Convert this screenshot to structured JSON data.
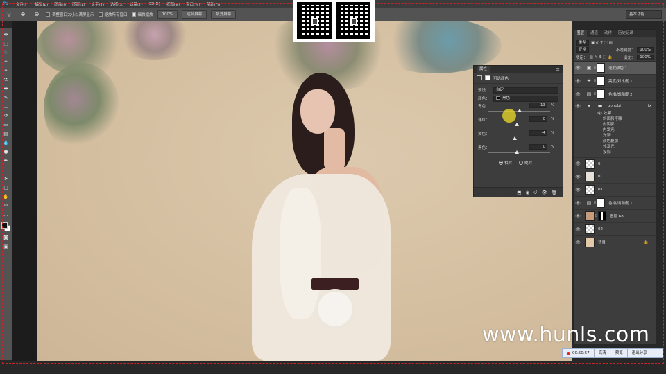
{
  "app": {
    "logo": "Ps",
    "workspace": "基本功能"
  },
  "menu": [
    "文件(F)",
    "编辑(E)",
    "图像(I)",
    "图层(L)",
    "文字(Y)",
    "选择(S)",
    "滤镜(T)",
    "3D(D)",
    "视图(V)",
    "窗口(W)",
    "帮助(H)"
  ],
  "options": {
    "resize_windows": "调整窗口大小以满屏显示",
    "zoom_all": "缩放所有窗口",
    "scrubby_zoom": "细微缩放",
    "zoom_level": "100%",
    "fit_screen": "适合屏幕",
    "fill_screen": "填充屏幕"
  },
  "properties": {
    "tab": "属性",
    "title": "可选颜色",
    "preset_label": "预设：",
    "preset_value": "自定",
    "colors_label": "颜色：",
    "colors_value": "黑色",
    "sliders": [
      {
        "label": "青色：",
        "value": "-13",
        "unit": "%"
      },
      {
        "label": "洋红：",
        "value": "0",
        "unit": "%"
      },
      {
        "label": "黄色：",
        "value": "-4",
        "unit": "%"
      },
      {
        "label": "黑色：",
        "value": "0",
        "unit": "%"
      }
    ],
    "relative": "相对",
    "absolute": "绝对"
  },
  "layers_panel": {
    "tabs": [
      "图层",
      "通道",
      "动作",
      "历史记录"
    ],
    "filter_kind": "类型",
    "blend_mode": "正常",
    "opacity_label": "不透明度：",
    "opacity": "100%",
    "lock_label": "锁定：",
    "fill_label": "填充：",
    "fill": "100%",
    "layers": [
      {
        "name": "选取颜色 1",
        "type": "adjustment"
      },
      {
        "name": "亮度/对比度 1",
        "type": "adjustment"
      },
      {
        "name": "色相/饱和度 2",
        "type": "adjustment"
      },
      {
        "name": "gongbi",
        "type": "group",
        "fx": "fx"
      },
      {
        "name": "0",
        "type": "pixel"
      },
      {
        "name": "0",
        "type": "pixel"
      },
      {
        "name": "01",
        "type": "pixel"
      },
      {
        "name": "色相/饱和度 1",
        "type": "adjustment"
      },
      {
        "name": "图层 68",
        "type": "pixel"
      },
      {
        "name": "02",
        "type": "pixel"
      },
      {
        "name": "背景",
        "type": "background"
      }
    ],
    "effects_title": "效果",
    "effects": [
      "斜面和浮雕",
      "内阴影",
      "内发光",
      "光泽",
      "颜色叠加",
      "外发光",
      "投影"
    ]
  },
  "watermark": "www.hunls.com",
  "recorder": {
    "time": "00:50:57",
    "hd": "高清",
    "preview": "预览",
    "exit_share": "退出分享"
  }
}
